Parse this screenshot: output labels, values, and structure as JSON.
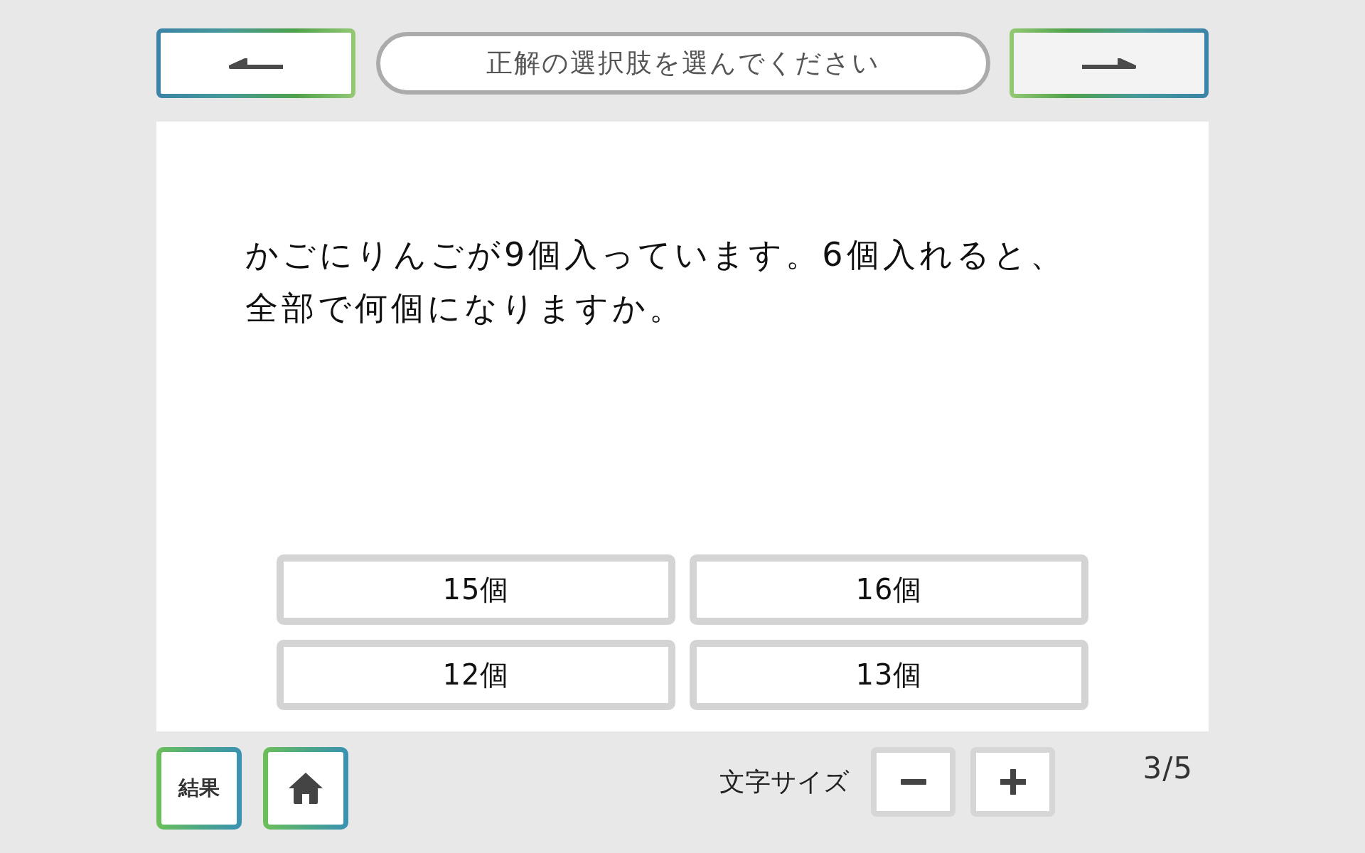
{
  "header": {
    "instruction": "正解の選択肢を選んでください"
  },
  "question": {
    "text": "かごにりんごが9個入っています。6個入れると、全部で何個になりますか。"
  },
  "choices": [
    {
      "label": "15個",
      "selected": false
    },
    {
      "label": "16個",
      "selected": false
    },
    {
      "label": "12個",
      "selected": false
    },
    {
      "label": "13個",
      "selected": false
    }
  ],
  "footer": {
    "result_button": "結果",
    "font_size_label": "文字サイズ",
    "page_counter": "3/5"
  }
}
